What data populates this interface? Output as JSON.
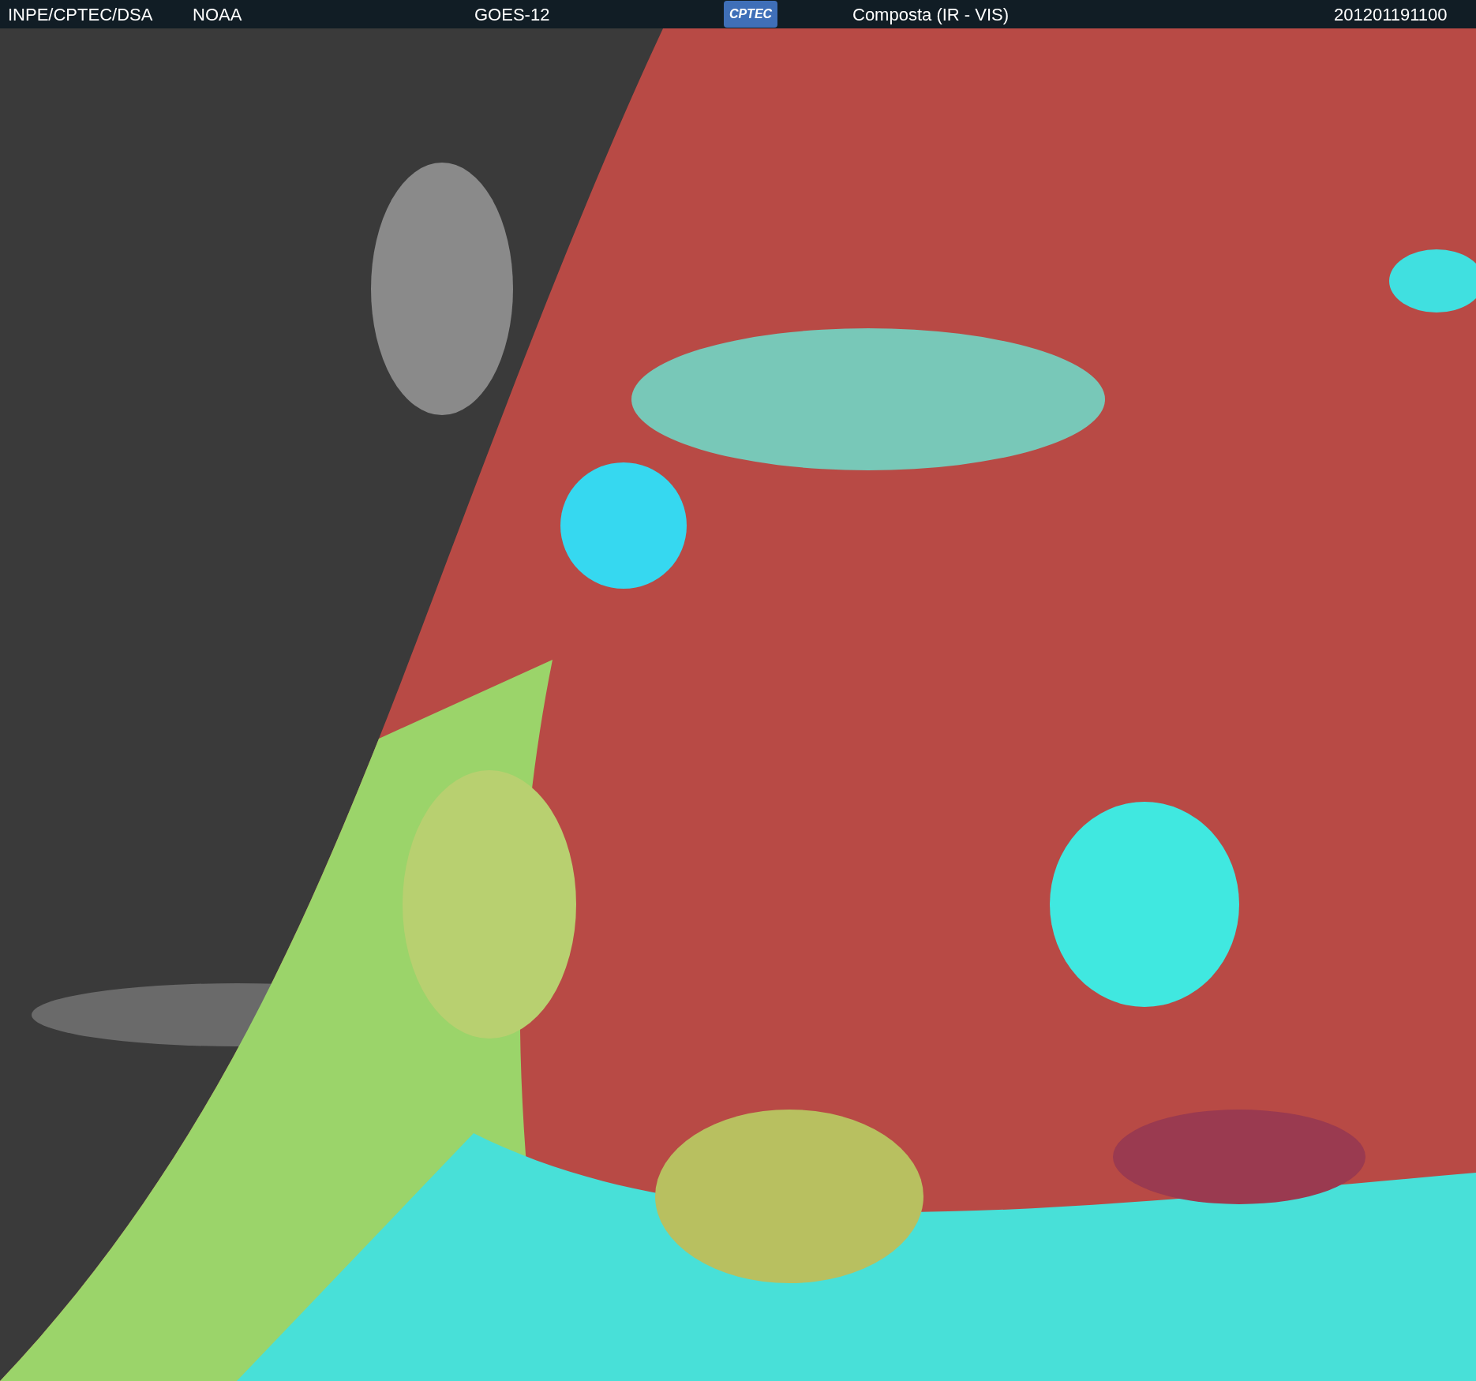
{
  "header": {
    "source": "INPE/CPTEC/DSA",
    "agency": "NOAA",
    "satellite": "GOES-12",
    "logo": "CPTEC",
    "product": "Composta (IR - VIS)",
    "timestamp": "201201191100"
  }
}
